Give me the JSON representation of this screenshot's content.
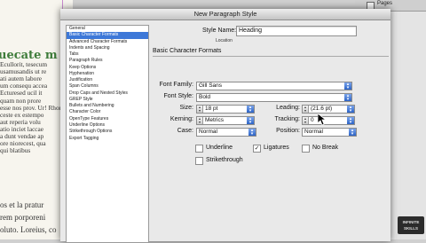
{
  "document": {
    "heading": "uecate m",
    "lines": [
      "Ecullorit, tesecum",
      "usamusandis ut re",
      "ati autem labore",
      "um consequ accea",
      "Ecturesed ucil it",
      "quam non prore",
      "esse nos prov. Ur! Rhore",
      "ceste ex estempo",
      "aut reperia volu",
      "atio inciet laccae",
      "a dunt vendae ap",
      "ore niorecest, qua",
      "qui blatibus"
    ],
    "bottom_lines": [
      "os et la pratur",
      "rem porporeni",
      "oluto. Loreius, co"
    ]
  },
  "pages_panel": {
    "label": "Pages"
  },
  "dialog": {
    "title": "New Paragraph Style",
    "sidebar_items": [
      "General",
      "Basic Character Formats",
      "Advanced Character Formats",
      "Indents and Spacing",
      "Tabs",
      "Paragraph Rules",
      "Keep Options",
      "Hyphenation",
      "Justification",
      "Span Columns",
      "Drop Caps and Nested Styles",
      "GREP Style",
      "Bullets and Numbering",
      "Character Color",
      "OpenType Features",
      "Underline Options",
      "Strikethrough Options",
      "Export Tagging"
    ],
    "selected_item": "Basic Character Formats",
    "style_name_label": "Style Name:",
    "style_name_value": "Heading",
    "location_label": "Location",
    "section_title": "Basic Character Formats",
    "font_family_label": "Font Family:",
    "font_family_value": "Gill Sans",
    "font_style_label": "Font Style:",
    "font_style_value": "Bold",
    "size_label": "Size:",
    "size_value": "18 pt",
    "leading_label": "Leading:",
    "leading_value": "(21.6 pt)",
    "kerning_label": "Kerning:",
    "kerning_value": "Metrics",
    "tracking_label": "Tracking:",
    "tracking_value": "0",
    "case_label": "Case:",
    "case_value": "Normal",
    "position_label": "Position:",
    "position_value": "Normal",
    "underline_label": "Underline",
    "underline_checked": false,
    "ligatures_label": "Ligatures",
    "ligatures_checked": true,
    "nobreak_label": "No Break",
    "nobreak_checked": false,
    "strikethrough_label": "Strikethrough",
    "strikethrough_checked": false
  },
  "watermark": {
    "line1": "INFINITE",
    "line2": "SKILLS"
  },
  "icons": {
    "dropdown": "chevron-updown-icon",
    "stepper": "up-down-stepper-icon",
    "check": "checkmark-icon",
    "cursor": "mouse-pointer-icon"
  },
  "colors": {
    "selection": "#3d78d8",
    "heading_green": "#3e7c3a",
    "guide": "#c98ad0"
  }
}
